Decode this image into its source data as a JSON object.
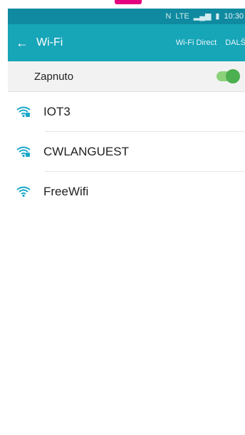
{
  "status_bar": {
    "network_label": "N",
    "lte_label": "LTE",
    "time": "10:30"
  },
  "app_bar": {
    "back_icon": "arrow-left",
    "title": "Wi-Fi",
    "wifi_direct": "Wi-Fi Direct",
    "more": "DALŠÍ"
  },
  "toggle": {
    "label": "Zapnuto",
    "on": true,
    "color": "#4caf50"
  },
  "networks": [
    {
      "name": "IOT3",
      "secured": true,
      "icon": "wifi-lock-icon"
    },
    {
      "name": "CWLANGUEST",
      "secured": true,
      "icon": "wifi-lock-icon"
    },
    {
      "name": "FreeWifi",
      "secured": false,
      "icon": "wifi-icon"
    }
  ],
  "colors": {
    "status_bar": "#0f8aa0",
    "app_bar": "#17a5b8",
    "wifi_icon": "#19a7c9",
    "accent_top": "#e5007d"
  }
}
